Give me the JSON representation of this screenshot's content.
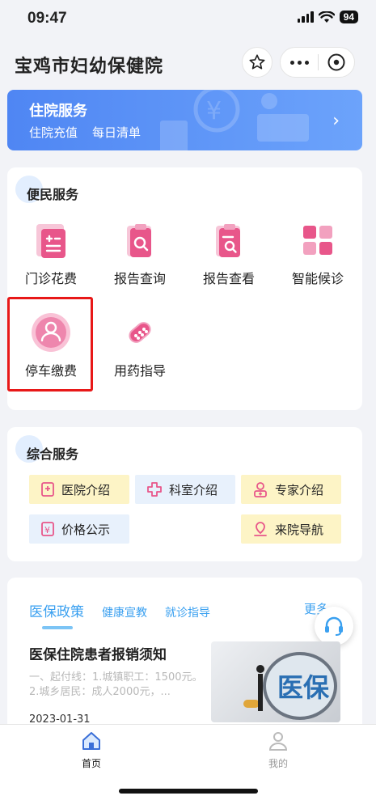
{
  "status_bar": {
    "time": "09:47",
    "battery": "94"
  },
  "navbar": {
    "title": "宝鸡市妇幼保健院"
  },
  "banner": {
    "title": "住院服务",
    "links": [
      "住院充值",
      "每日清单"
    ],
    "arrow": "›"
  },
  "convenience": {
    "title": "便民服务",
    "items": [
      {
        "label": "门诊花费",
        "icon": "bill-icon"
      },
      {
        "label": "报告查询",
        "icon": "report-search-icon"
      },
      {
        "label": "报告查看",
        "icon": "report-view-icon"
      },
      {
        "label": "智能候诊",
        "icon": "grid-icon"
      },
      {
        "label": "停车缴费",
        "icon": "parking-user-icon"
      },
      {
        "label": "用药指导",
        "icon": "pill-icon"
      }
    ]
  },
  "comprehensive": {
    "title": "综合服务",
    "items": [
      {
        "label": "医院介绍",
        "icon": "hospital-icon"
      },
      {
        "label": "科室介绍",
        "icon": "department-icon"
      },
      {
        "label": "专家介绍",
        "icon": "expert-icon"
      },
      {
        "label": "价格公示",
        "icon": "price-icon"
      },
      {
        "label": "来院导航",
        "icon": "navigation-icon"
      }
    ]
  },
  "news": {
    "tabs": [
      "医保政策",
      "健康宣教",
      "就诊指导"
    ],
    "more": "更多",
    "article": {
      "title": "医保住院患者报销须知",
      "summary": "一、起付线：1.城镇职工：1500元。2.城乡居民：成人2000元，...",
      "date": "2023-01-31",
      "image_text": "医保"
    }
  },
  "tabbar": {
    "items": [
      {
        "label": "首页"
      },
      {
        "label": "我的"
      }
    ]
  },
  "colors": {
    "accent": "#3aa0f0",
    "banner": "#5a92f5",
    "pink": "#e8568a",
    "highlight": "#e81818"
  }
}
